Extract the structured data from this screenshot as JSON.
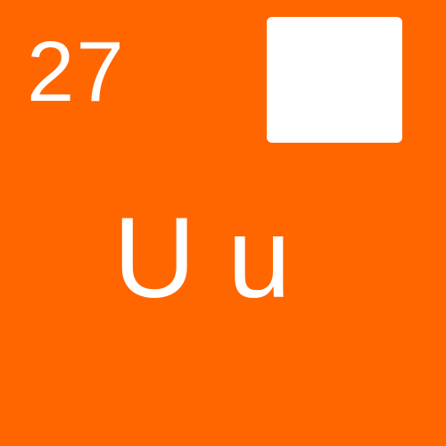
{
  "card": {
    "number": "27",
    "letters": "U u",
    "background_color": "#ff6600",
    "foreground_color": "#ffffff"
  },
  "square": {
    "color": "#ffffff"
  }
}
